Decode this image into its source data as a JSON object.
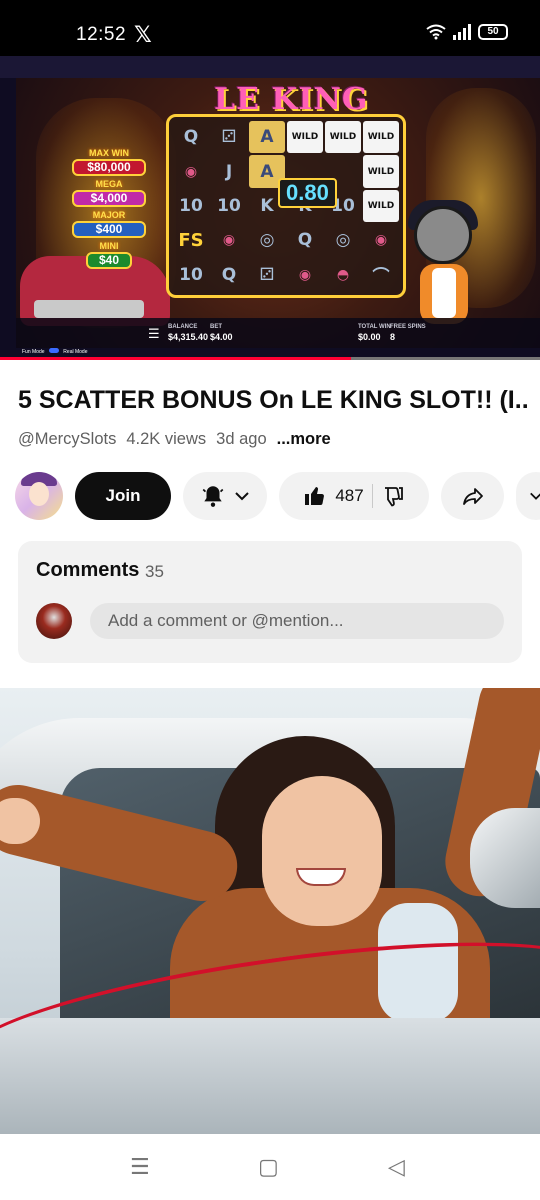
{
  "status": {
    "time": "12:52",
    "battery": "50"
  },
  "video": {
    "logo": "LE KING",
    "jackpots": [
      {
        "name": "MAX WIN",
        "amount": "$80,000"
      },
      {
        "name": "MEGA",
        "amount": "$4,000"
      },
      {
        "name": "MAJOR",
        "amount": "$400"
      },
      {
        "name": "MINI",
        "amount": "$40"
      }
    ],
    "multiplier": "0.80",
    "hud": {
      "balance_label": "BALANCE",
      "balance": "$4,315.40",
      "bet_label": "BET",
      "bet": "$4.00",
      "total_win_label": "TOTAL WIN",
      "total_win": "$0.00",
      "free_spins_label": "FREE SPINS",
      "free_spins": "8"
    },
    "mode_fun": "Fun Mode",
    "mode_real": "Real Mode",
    "progress_fraction": 0.65
  },
  "title": "5 SCATTER BONUS On LE KING SLOT!! (I...",
  "meta": {
    "channel": "@MercySlots",
    "views": "4.2K views",
    "age": "3d ago",
    "more": "...more"
  },
  "actions": {
    "join": "Join",
    "likes": "487"
  },
  "comments": {
    "title": "Comments",
    "count": "35",
    "placeholder": "Add a comment or @mention..."
  },
  "icons": [
    "x-icon",
    "wifi-icon",
    "signal-icon",
    "battery-icon",
    "bell-icon",
    "chevron-down-icon",
    "like-icon",
    "dislike-icon",
    "share-icon",
    "menu-icon",
    "square-icon",
    "back-icon"
  ]
}
